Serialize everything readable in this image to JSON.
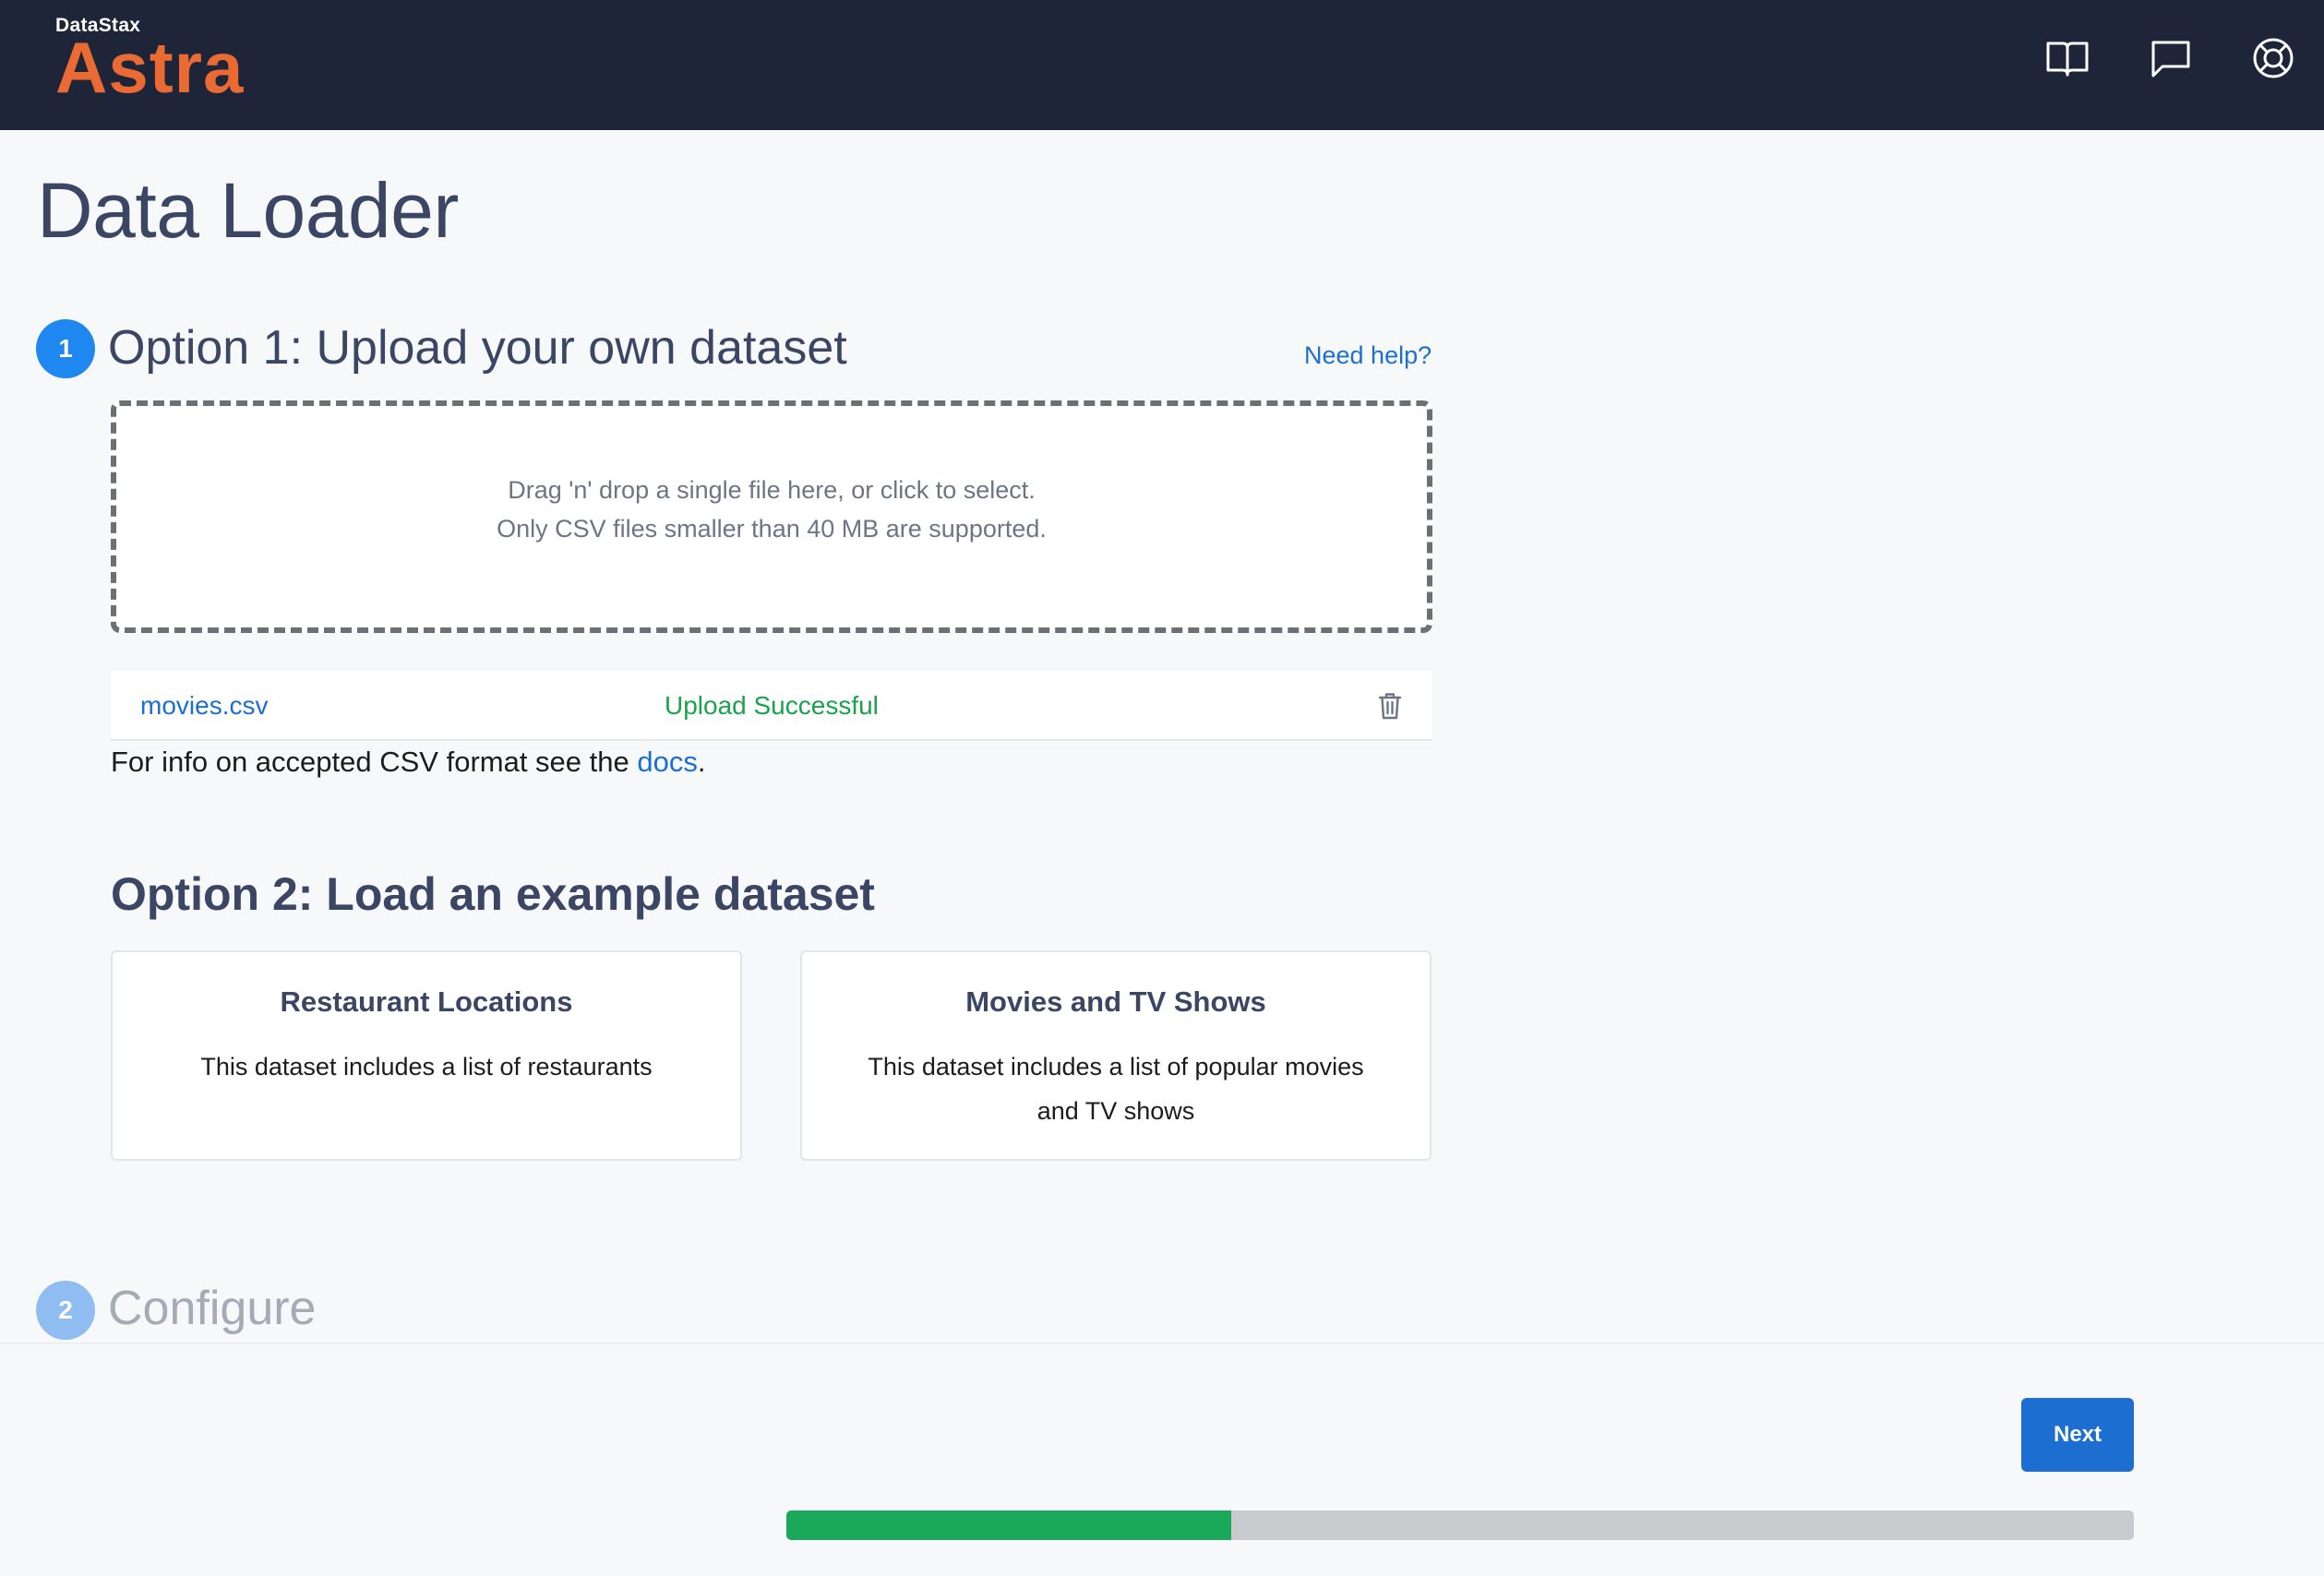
{
  "header": {
    "brand_company": "DataStax",
    "brand_product": "Astra",
    "icons": [
      "docs-book-icon",
      "chat-icon",
      "help-lifebuoy-icon"
    ]
  },
  "page": {
    "title": "Data Loader"
  },
  "step1": {
    "number": "1",
    "heading": "Option 1: Upload your own dataset",
    "help_link": "Need help?",
    "dropzone": {
      "line1": "Drag 'n' drop a single file here, or click to select.",
      "line2": "Only CSV files smaller than 40 MB are supported."
    },
    "uploaded_file": {
      "name": "movies.csv",
      "status": "Upload Successful"
    },
    "csv_info_prefix": "For info on accepted CSV format see the ",
    "csv_info_link": "docs",
    "csv_info_suffix": "."
  },
  "option2": {
    "heading": "Option 2: Load an example dataset",
    "cards": [
      {
        "title": "Restaurant Locations",
        "description": "This dataset includes a list of restaurants"
      },
      {
        "title": "Movies and TV Shows",
        "description": "This dataset includes a list of popular movies and TV shows"
      }
    ]
  },
  "step2": {
    "number": "2",
    "heading": "Configure"
  },
  "footer": {
    "next_label": "Next",
    "progress_fraction": 0.33
  },
  "colors": {
    "header_bg": "#1f2538",
    "brand_orange": "#ea6a34",
    "link_blue": "#1b6fcf",
    "success_green": "#1aa34a",
    "progress_green": "#1aa95a",
    "primary_button": "#1c6ed1"
  }
}
